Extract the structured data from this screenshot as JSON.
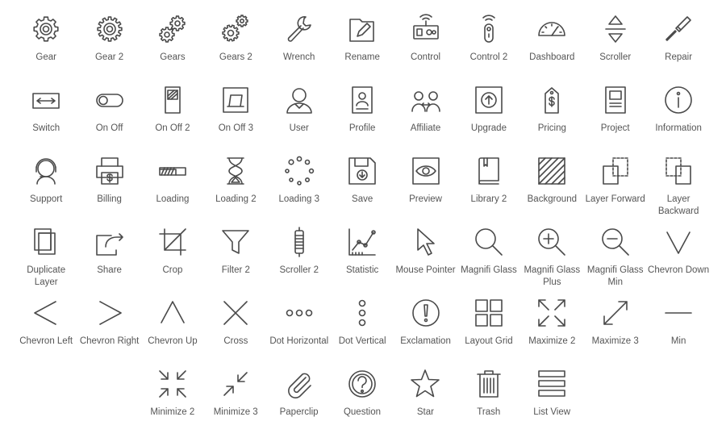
{
  "icons": [
    [
      {
        "label": "Gear",
        "icon": "gear-icon"
      },
      {
        "label": "Gear 2",
        "icon": "gear-2-icon"
      },
      {
        "label": "Gears",
        "icon": "gears-icon"
      },
      {
        "label": "Gears 2",
        "icon": "gears-2-icon"
      },
      {
        "label": "Wrench",
        "icon": "wrench-icon"
      },
      {
        "label": "Rename",
        "icon": "rename-icon"
      },
      {
        "label": "Control",
        "icon": "control-icon"
      },
      {
        "label": "Control 2",
        "icon": "control-2-icon"
      },
      {
        "label": "Dashboard",
        "icon": "dashboard-icon"
      },
      {
        "label": "Scroller",
        "icon": "scroller-icon"
      },
      {
        "label": "Repair",
        "icon": "repair-icon"
      }
    ],
    [
      {
        "label": "Switch",
        "icon": "switch-icon"
      },
      {
        "label": "On Off",
        "icon": "on-off-icon"
      },
      {
        "label": "On Off 2",
        "icon": "on-off-2-icon"
      },
      {
        "label": "On Off 3",
        "icon": "on-off-3-icon"
      },
      {
        "label": "User",
        "icon": "user-icon"
      },
      {
        "label": "Profile",
        "icon": "profile-icon"
      },
      {
        "label": "Affiliate",
        "icon": "affiliate-icon"
      },
      {
        "label": "Upgrade",
        "icon": "upgrade-icon"
      },
      {
        "label": "Pricing",
        "icon": "pricing-icon"
      },
      {
        "label": "Project",
        "icon": "project-icon"
      },
      {
        "label": "Information",
        "icon": "information-icon"
      }
    ],
    [
      {
        "label": "Support",
        "icon": "support-icon"
      },
      {
        "label": "Billing",
        "icon": "billing-icon"
      },
      {
        "label": "Loading",
        "icon": "loading-icon"
      },
      {
        "label": "Loading 2",
        "icon": "loading-2-icon"
      },
      {
        "label": "Loading 3",
        "icon": "loading-3-icon"
      },
      {
        "label": "Save",
        "icon": "save-icon"
      },
      {
        "label": "Preview",
        "icon": "preview-icon"
      },
      {
        "label": "Library 2",
        "icon": "library-2-icon"
      },
      {
        "label": "Background",
        "icon": "background-icon"
      },
      {
        "label": "Layer Forward",
        "icon": "layer-forward-icon"
      },
      {
        "label": "Layer Backward",
        "icon": "layer-backward-icon"
      }
    ],
    [
      {
        "label": "Duplicate Layer",
        "icon": "duplicate-layer-icon"
      },
      {
        "label": "Share",
        "icon": "share-icon"
      },
      {
        "label": "Crop",
        "icon": "crop-icon"
      },
      {
        "label": "Filter 2",
        "icon": "filter-2-icon"
      },
      {
        "label": "Scroller 2",
        "icon": "scroller-2-icon"
      },
      {
        "label": "Statistic",
        "icon": "statistic-icon"
      },
      {
        "label": "Mouse Pointer",
        "icon": "mouse-pointer-icon"
      },
      {
        "label": "Magnifi Glass",
        "icon": "magnifi-glass-icon"
      },
      {
        "label": "Magnifi Glass Plus",
        "icon": "magnifi-glass-plus-icon"
      },
      {
        "label": "Magnifi Glass Min",
        "icon": "magnifi-glass-min-icon"
      },
      {
        "label": "Chevron Down",
        "icon": "chevron-down-icon"
      }
    ],
    [
      {
        "label": "Chevron Left",
        "icon": "chevron-left-icon"
      },
      {
        "label": "Chevron Right",
        "icon": "chevron-right-icon"
      },
      {
        "label": "Chevron Up",
        "icon": "chevron-up-icon"
      },
      {
        "label": "Cross",
        "icon": "cross-icon"
      },
      {
        "label": "Dot Horizontal",
        "icon": "dot-horizontal-icon"
      },
      {
        "label": "Dot Vertical",
        "icon": "dot-vertical-icon"
      },
      {
        "label": "Exclamation",
        "icon": "exclamation-icon"
      },
      {
        "label": "Layout Grid",
        "icon": "layout-grid-icon"
      },
      {
        "label": "Maximize 2",
        "icon": "maximize-2-icon"
      },
      {
        "label": "Maximize 3",
        "icon": "maximize-3-icon"
      },
      {
        "label": "Min",
        "icon": "min-icon"
      }
    ],
    [
      {
        "label": "Minimize 2",
        "icon": "minimize-2-icon"
      },
      {
        "label": "Minimize 3",
        "icon": "minimize-3-icon"
      },
      {
        "label": "Paperclip",
        "icon": "paperclip-icon"
      },
      {
        "label": "Question",
        "icon": "question-icon"
      },
      {
        "label": "Star",
        "icon": "star-icon"
      },
      {
        "label": "Trash",
        "icon": "trash-icon"
      },
      {
        "label": "List View",
        "icon": "list-view-icon"
      }
    ]
  ]
}
